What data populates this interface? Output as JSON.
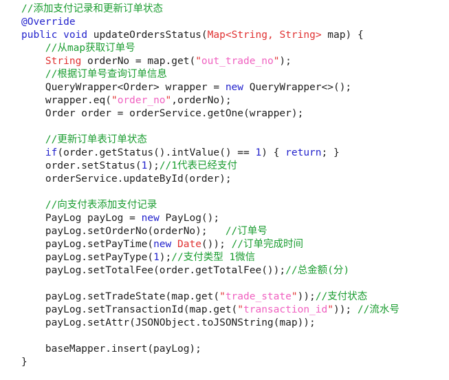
{
  "editor": {
    "language": "Java",
    "background_color": "#ffffff",
    "indent_unit": "    "
  },
  "theme": {
    "plain_color": "#1c1c1c",
    "comment_color": "#1a9c30",
    "keyword_color": "#2222cc",
    "class_color": "#e03030",
    "string_color": "#f060c0",
    "quote_color": "#e03030",
    "number_color": "#2222cc"
  },
  "code": {
    "lines": [
      {
        "indent": 0,
        "tokens": [
          {
            "t": "comment",
            "v": "//添加支付记录和更新订单状态"
          }
        ]
      },
      {
        "indent": 0,
        "tokens": [
          {
            "t": "annot",
            "v": "@Override"
          }
        ]
      },
      {
        "indent": 0,
        "tokens": [
          {
            "t": "keyword",
            "v": "public"
          },
          {
            "t": "plain",
            "v": " "
          },
          {
            "t": "keyword",
            "v": "void"
          },
          {
            "t": "plain",
            "v": " updateOrdersStatus("
          },
          {
            "t": "class",
            "v": "Map"
          },
          {
            "t": "class",
            "v": "<"
          },
          {
            "t": "class",
            "v": "String"
          },
          {
            "t": "class",
            "v": ", "
          },
          {
            "t": "class",
            "v": "String"
          },
          {
            "t": "class",
            "v": ">"
          },
          {
            "t": "plain",
            "v": " map) {"
          }
        ]
      },
      {
        "indent": 1,
        "tokens": [
          {
            "t": "comment",
            "v": "//从map获取订单号"
          }
        ]
      },
      {
        "indent": 1,
        "tokens": [
          {
            "t": "class",
            "v": "String"
          },
          {
            "t": "plain",
            "v": " orderNo = map.get("
          },
          {
            "t": "quote",
            "v": "\""
          },
          {
            "t": "string",
            "v": "out_trade_no"
          },
          {
            "t": "quote",
            "v": "\""
          },
          {
            "t": "plain",
            "v": ");"
          }
        ]
      },
      {
        "indent": 1,
        "tokens": [
          {
            "t": "comment",
            "v": "//根据订单号查询订单信息"
          }
        ]
      },
      {
        "indent": 1,
        "tokens": [
          {
            "t": "plain",
            "v": "QueryWrapper<Order> wrapper = "
          },
          {
            "t": "keyword",
            "v": "new"
          },
          {
            "t": "plain",
            "v": " QueryWrapper<>();"
          }
        ]
      },
      {
        "indent": 1,
        "tokens": [
          {
            "t": "plain",
            "v": "wrapper.eq("
          },
          {
            "t": "quote",
            "v": "\""
          },
          {
            "t": "string",
            "v": "order_no"
          },
          {
            "t": "quote",
            "v": "\""
          },
          {
            "t": "plain",
            "v": ",orderNo);"
          }
        ]
      },
      {
        "indent": 1,
        "tokens": [
          {
            "t": "plain",
            "v": "Order order = orderService.getOne(wrapper);"
          }
        ]
      },
      {
        "indent": 0,
        "blank": true,
        "tokens": []
      },
      {
        "indent": 1,
        "tokens": [
          {
            "t": "comment",
            "v": "//更新订单表订单状态"
          }
        ]
      },
      {
        "indent": 1,
        "tokens": [
          {
            "t": "keyword",
            "v": "if"
          },
          {
            "t": "plain",
            "v": "(order.getStatus().intValue() == "
          },
          {
            "t": "number",
            "v": "1"
          },
          {
            "t": "plain",
            "v": ") { "
          },
          {
            "t": "keyword",
            "v": "return"
          },
          {
            "t": "plain",
            "v": "; }"
          }
        ]
      },
      {
        "indent": 1,
        "tokens": [
          {
            "t": "plain",
            "v": "order.setStatus("
          },
          {
            "t": "number",
            "v": "1"
          },
          {
            "t": "plain",
            "v": ");"
          },
          {
            "t": "comment",
            "v": "//1代表已经支付"
          }
        ]
      },
      {
        "indent": 1,
        "tokens": [
          {
            "t": "plain",
            "v": "orderService.updateById(order);"
          }
        ]
      },
      {
        "indent": 0,
        "blank": true,
        "tokens": []
      },
      {
        "indent": 1,
        "tokens": [
          {
            "t": "comment",
            "v": "//向支付表添加支付记录"
          }
        ]
      },
      {
        "indent": 1,
        "tokens": [
          {
            "t": "plain",
            "v": "PayLog payLog = "
          },
          {
            "t": "keyword",
            "v": "new"
          },
          {
            "t": "plain",
            "v": " PayLog();"
          }
        ]
      },
      {
        "indent": 1,
        "tokens": [
          {
            "t": "plain",
            "v": "payLog.setOrderNo(orderNo);   "
          },
          {
            "t": "comment",
            "v": "//订单号"
          }
        ]
      },
      {
        "indent": 1,
        "tokens": [
          {
            "t": "plain",
            "v": "payLog.setPayTime("
          },
          {
            "t": "keyword",
            "v": "new"
          },
          {
            "t": "plain",
            "v": " "
          },
          {
            "t": "class",
            "v": "Date"
          },
          {
            "t": "plain",
            "v": "()); "
          },
          {
            "t": "comment",
            "v": "//订单完成时间"
          }
        ]
      },
      {
        "indent": 1,
        "tokens": [
          {
            "t": "plain",
            "v": "payLog.setPayType("
          },
          {
            "t": "number",
            "v": "1"
          },
          {
            "t": "plain",
            "v": ");"
          },
          {
            "t": "comment",
            "v": "//支付类型 1微信"
          }
        ]
      },
      {
        "indent": 1,
        "tokens": [
          {
            "t": "plain",
            "v": "payLog.setTotalFee(order.getTotalFee());"
          },
          {
            "t": "comment",
            "v": "//总金额(分)"
          }
        ]
      },
      {
        "indent": 0,
        "blank": true,
        "tokens": []
      },
      {
        "indent": 1,
        "tokens": [
          {
            "t": "plain",
            "v": "payLog.setTradeState(map.get("
          },
          {
            "t": "quote",
            "v": "\""
          },
          {
            "t": "string",
            "v": "trade_state"
          },
          {
            "t": "quote",
            "v": "\""
          },
          {
            "t": "plain",
            "v": "));"
          },
          {
            "t": "comment",
            "v": "//支付状态"
          }
        ]
      },
      {
        "indent": 1,
        "tokens": [
          {
            "t": "plain",
            "v": "payLog.setTransactionId(map.get("
          },
          {
            "t": "quote",
            "v": "\""
          },
          {
            "t": "string",
            "v": "transaction_id"
          },
          {
            "t": "quote",
            "v": "\""
          },
          {
            "t": "plain",
            "v": ")); "
          },
          {
            "t": "comment",
            "v": "//流水号"
          }
        ]
      },
      {
        "indent": 1,
        "tokens": [
          {
            "t": "plain",
            "v": "payLog.setAttr(JSONObject.toJSONString(map));"
          }
        ]
      },
      {
        "indent": 0,
        "blank": true,
        "tokens": []
      },
      {
        "indent": 1,
        "tokens": [
          {
            "t": "plain",
            "v": "baseMapper.insert(payLog);"
          }
        ]
      },
      {
        "indent": 0,
        "tokens": [
          {
            "t": "plain",
            "v": "}"
          }
        ]
      }
    ]
  }
}
